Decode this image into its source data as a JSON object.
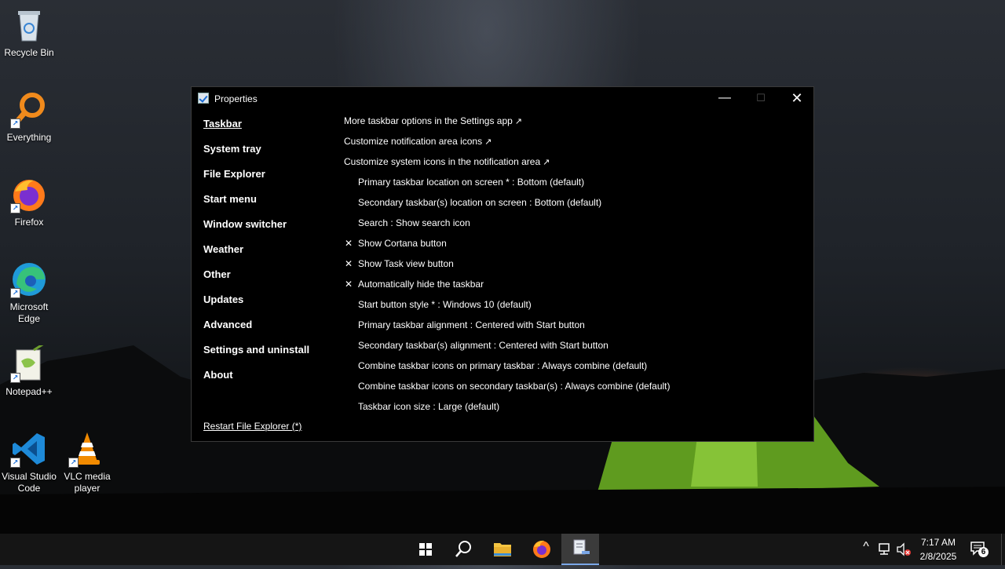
{
  "desktop": {
    "icons": [
      {
        "label": "Recycle Bin"
      },
      {
        "label": "Everything"
      },
      {
        "label": "Firefox"
      },
      {
        "label": "Microsoft Edge"
      },
      {
        "label": "Notepad++"
      },
      {
        "label": "Visual Studio Code"
      },
      {
        "label": "VLC media player"
      }
    ]
  },
  "window": {
    "title": "Properties",
    "controls": {
      "minimize": "—",
      "maximize": "☐",
      "close": "✕"
    },
    "nav": [
      {
        "label": "Taskbar",
        "active": true
      },
      {
        "label": "System tray"
      },
      {
        "label": "File Explorer"
      },
      {
        "label": "Start menu"
      },
      {
        "label": "Window switcher"
      },
      {
        "label": "Weather"
      },
      {
        "label": "Other"
      },
      {
        "label": "Updates"
      },
      {
        "label": "Advanced"
      },
      {
        "label": "Settings and uninstall"
      },
      {
        "label": "About"
      }
    ],
    "restart_link": "Restart File Explorer (*)",
    "options": [
      {
        "label": "More taskbar options in the Settings app",
        "link_arrow": "↗"
      },
      {
        "label": "Customize notification area icons",
        "link_arrow": "↗"
      },
      {
        "label": "Customize system icons in the notification area",
        "link_arrow": "↗"
      },
      {
        "label": "Primary taskbar location on screen * : Bottom (default)"
      },
      {
        "label": "Secondary taskbar(s) location on screen : Bottom (default)"
      },
      {
        "label": "Search : Show search icon"
      },
      {
        "label": "Show Cortana button",
        "mark": "✕"
      },
      {
        "label": "Show Task view button",
        "mark": "✕"
      },
      {
        "label": "Automatically hide the taskbar",
        "mark": "✕"
      },
      {
        "label": "Start button style * : Windows 10 (default)"
      },
      {
        "label": "Primary taskbar alignment : Centered with Start button"
      },
      {
        "label": "Secondary taskbar(s) alignment : Centered with Start button"
      },
      {
        "label": "Combine taskbar icons on primary taskbar : Always combine (default)"
      },
      {
        "label": "Combine taskbar icons on secondary taskbar(s) : Always combine (default)"
      },
      {
        "label": "Taskbar icon size : Large (default)"
      }
    ]
  },
  "taskbar": {
    "apps": [
      "start-icon",
      "search-icon",
      "file-explorer-icon",
      "firefox-icon",
      "properties-app-icon"
    ],
    "tray": {
      "chevron": "^",
      "time": "7:17 AM",
      "date": "2/8/2025",
      "notification_count": "6"
    }
  }
}
